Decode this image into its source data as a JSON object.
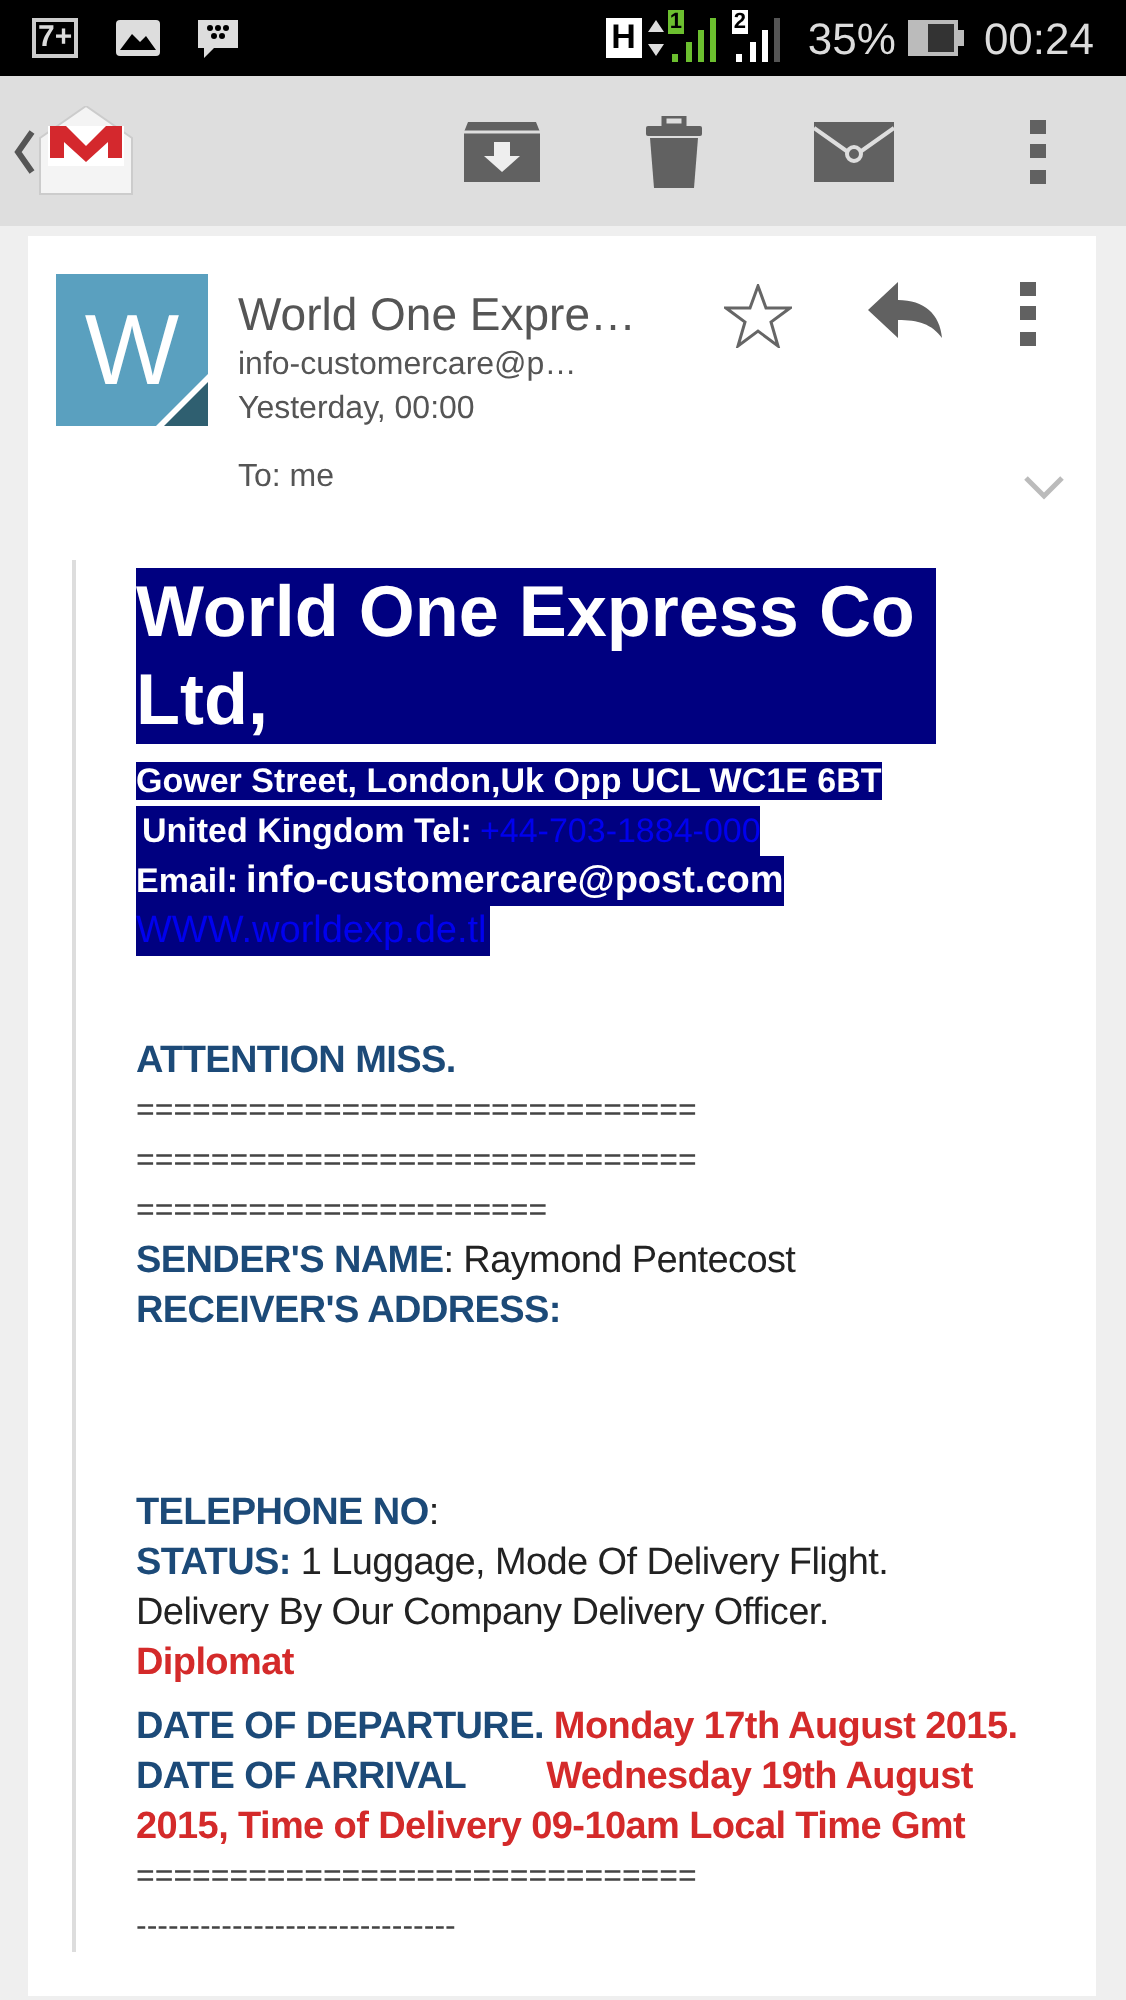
{
  "status_bar": {
    "notification_count": "7+",
    "network_type": "H",
    "sim_1": "1",
    "sim_2": "2",
    "battery": "35%",
    "time": "00:24"
  },
  "message": {
    "avatar_letter": "W",
    "sender": "World One Expre…",
    "address": "info-customercare@p…",
    "date": "Yesterday, 00:00",
    "recipients": "To: me",
    "starred": false
  },
  "company": {
    "name": "World One Express Co Ltd,",
    "address": "Gower Street, London,Uk Opp UCL WC1E 6BT",
    "tel_label": "United Kingdom Tel:",
    "tel": "+44-703-1884-000",
    "email_label": "Email:",
    "email": "info-customercare@post.com",
    "website": "WWW.worldexp.de.tl"
  },
  "paragraphs": [
    [
      {
        "kind": "field",
        "parts": [
          {
            "kind": "label",
            "text": "ATTENTION MISS."
          }
        ]
      },
      {
        "kind": "rule",
        "text": "=============================="
      },
      {
        "kind": "rule",
        "text": "=============================="
      },
      {
        "kind": "rule",
        "text": "======================"
      },
      {
        "kind": "field",
        "parts": [
          {
            "kind": "label",
            "text": "SENDER'S NAME"
          },
          {
            "kind": "value",
            "text": ":  Raymond Pentecost"
          }
        ]
      },
      {
        "kind": "field",
        "parts": [
          {
            "kind": "label",
            "text": "RECEIVER'S ADDRESS:"
          }
        ]
      }
    ],
    [
      {
        "kind": "field",
        "parts": [
          {
            "kind": "label",
            "text": "TELEPHONE NO"
          },
          {
            "kind": "value",
            "text": ":"
          }
        ]
      },
      {
        "kind": "field",
        "parts": [
          {
            "kind": "label",
            "text": "STATUS:"
          },
          {
            "kind": "value",
            "text": " 1 Luggage, Mode Of Delivery Flight."
          }
        ]
      },
      {
        "kind": "field",
        "parts": [
          {
            "kind": "value",
            "text": "Delivery By Our Company Delivery Officer."
          }
        ]
      },
      {
        "kind": "field",
        "parts": [
          {
            "kind": "alert",
            "text": "Diplomat"
          }
        ]
      }
    ],
    [
      {
        "kind": "field",
        "parts": [
          {
            "kind": "label",
            "text": "DATE OF DEPARTURE."
          },
          {
            "kind": "alert",
            "text": " Monday 17th August 2015."
          }
        ]
      },
      {
        "kind": "field",
        "parts": [
          {
            "kind": "label",
            "text": "DATE OF ARRIVAL"
          },
          {
            "kind": "gap_alert",
            "text": "Wednesday 19th August 2015, Time of Delivery 09-10am Local Time Gmt"
          }
        ]
      },
      {
        "kind": "rule",
        "text": "=============================="
      },
      {
        "kind": "rule",
        "text": "------------------------------"
      }
    ]
  ]
}
